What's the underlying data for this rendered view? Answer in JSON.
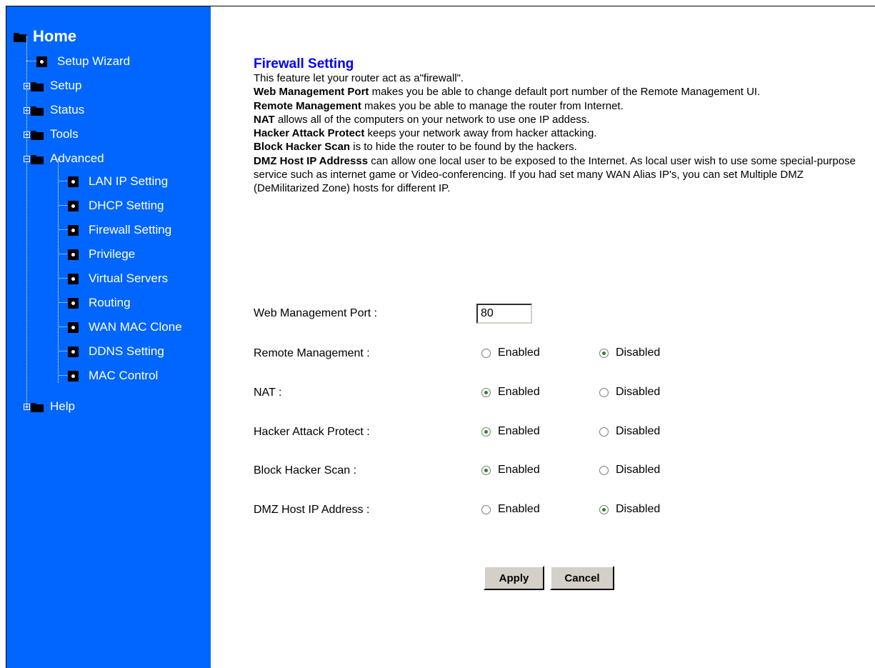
{
  "sidebar": {
    "home": {
      "label": "Home"
    },
    "items": [
      {
        "label": "Setup Wizard",
        "type": "page"
      },
      {
        "label": "Setup",
        "type": "folder",
        "expanded": false
      },
      {
        "label": "Status",
        "type": "folder",
        "expanded": false
      },
      {
        "label": "Tools",
        "type": "folder",
        "expanded": false
      },
      {
        "label": "Advanced",
        "type": "folder",
        "expanded": true
      },
      {
        "label": "Help",
        "type": "folder",
        "expanded": false
      }
    ],
    "advanced_children": [
      {
        "label": "LAN IP Setting"
      },
      {
        "label": "DHCP Setting"
      },
      {
        "label": "Firewall Setting"
      },
      {
        "label": "Privilege"
      },
      {
        "label": "Virtual Servers"
      },
      {
        "label": "Routing"
      },
      {
        "label": "WAN MAC Clone"
      },
      {
        "label": "DDNS Setting"
      },
      {
        "label": "MAC Control"
      }
    ]
  },
  "main": {
    "title": "Firewall Setting",
    "intro": "This feature let your router act as a\"firewall\".",
    "descriptions": [
      {
        "term": "Web Management Port",
        "text": " makes you be able to change default port number of the Remote Management UI."
      },
      {
        "term": "Remote Management",
        "text": " makes you be able to manage the router from Internet."
      },
      {
        "term": "NAT",
        "text": " allows all of the computers on your network to use one IP addess."
      },
      {
        "term": "Hacker Attack Protect",
        "text": " keeps your network away from hacker attacking."
      },
      {
        "term": "Block Hacker Scan",
        "text": " is to hide the router to be found by the hackers."
      },
      {
        "term": "DMZ Host IP Addresss",
        "text": " can allow one local user to be exposed to the Internet. As local user wish to use some special-purpose service such as internet game or Video-conferencing.  If you had set many WAN Alias IP's, you can set Multiple DMZ (DeMilitarized Zone) hosts for different IP."
      }
    ],
    "form": {
      "port_label": "Web Management Port :",
      "port_value": "80",
      "enabled_label": "Enabled",
      "disabled_label": "Disabled",
      "options": [
        {
          "label": "Remote Management :",
          "enabled": false
        },
        {
          "label": "NAT :",
          "enabled": true
        },
        {
          "label": "Hacker Attack Protect :",
          "enabled": true
        },
        {
          "label": "Block Hacker Scan :",
          "enabled": true
        },
        {
          "label": "DMZ Host IP Address :",
          "enabled": false
        }
      ]
    },
    "buttons": {
      "apply": "Apply",
      "cancel": "Cancel"
    }
  },
  "colors": {
    "sidebar_bg": "#0066ff",
    "title": "#0000ff",
    "radio_selected": "#1f8a1f"
  },
  "icons": {
    "folder": "folder-icon",
    "page": "page-icon",
    "expander": "expander-icon"
  }
}
